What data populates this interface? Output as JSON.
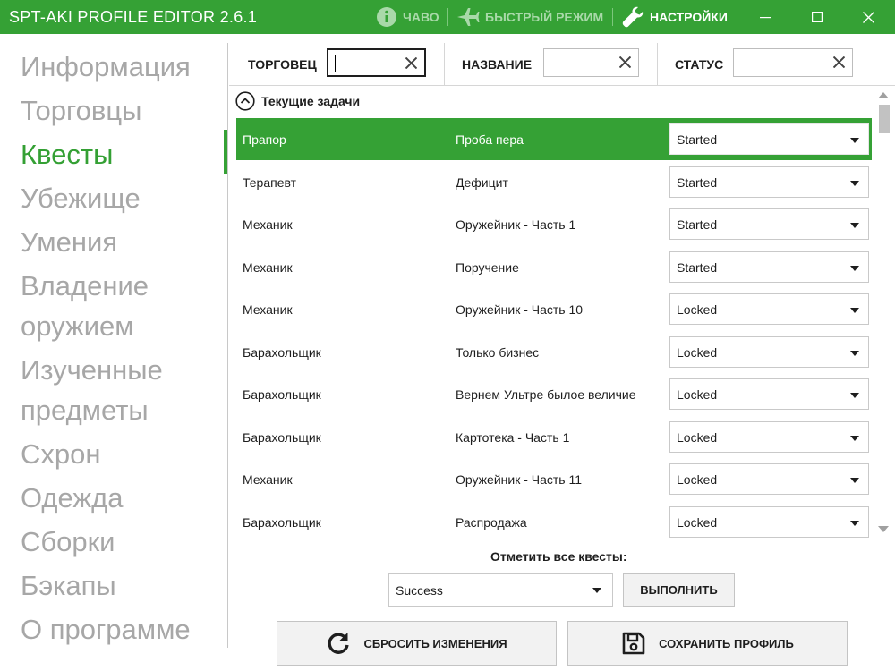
{
  "titlebar": {
    "app_title": "SPT-AKI PROFILE EDITOR  2.6.1",
    "faq_label": "ЧАВО",
    "fast_mode_label": "БЫСТРЫЙ РЕЖИМ",
    "settings_label": "НАСТРОЙКИ",
    "bg_color": "#35a135"
  },
  "sidebar": {
    "items": [
      {
        "label": "Информация"
      },
      {
        "label": "Торговцы"
      },
      {
        "label": "Квесты"
      },
      {
        "label": "Убежище"
      },
      {
        "label": "Умения"
      },
      {
        "label": "Владение"
      },
      {
        "label": "оружием"
      },
      {
        "label": "Изученные"
      },
      {
        "label": "предметы"
      },
      {
        "label": "Схрон"
      },
      {
        "label": "Одежда"
      },
      {
        "label": "Сборки"
      },
      {
        "label": "Бэкапы"
      },
      {
        "label": "О программе"
      }
    ],
    "active": "Квесты"
  },
  "filters": {
    "trader_label": "ТОРГОВЕЦ",
    "trader_value": "",
    "name_label": "НАЗВАНИЕ",
    "name_value": "",
    "status_label": "СТАТУС",
    "status_value": ""
  },
  "section": {
    "title": "Текущие задачи"
  },
  "quests": [
    {
      "trader": "Прапор",
      "name": "Проба пера",
      "status": "Started",
      "selected": true
    },
    {
      "trader": "Терапевт",
      "name": "Дефицит",
      "status": "Started"
    },
    {
      "trader": "Механик",
      "name": "Оружейник - Часть 1",
      "status": "Started"
    },
    {
      "trader": "Механик",
      "name": "Поручение",
      "status": "Started"
    },
    {
      "trader": "Механик",
      "name": "Оружейник - Часть 10",
      "status": "Locked"
    },
    {
      "trader": "Барахольщик",
      "name": "Только бизнес",
      "status": "Locked"
    },
    {
      "trader": "Барахольщик",
      "name": "Вернем Ультре былое величие",
      "status": "Locked"
    },
    {
      "trader": "Барахольщик",
      "name": "Картотека - Часть 1",
      "status": "Locked"
    },
    {
      "trader": "Механик",
      "name": "Оружейник - Часть 11",
      "status": "Locked"
    },
    {
      "trader": "Барахольщик",
      "name": "Распродажа",
      "status": "Locked"
    }
  ],
  "bulk": {
    "label": "Отметить все квесты:",
    "selected_status": "Success",
    "execute_label": "ВЫПОЛНИТЬ"
  },
  "actions": {
    "reset_label": "СБРОСИТЬ ИЗМЕНЕНИЯ",
    "save_label": "СОХРАНИТЬ ПРОФИЛЬ"
  }
}
